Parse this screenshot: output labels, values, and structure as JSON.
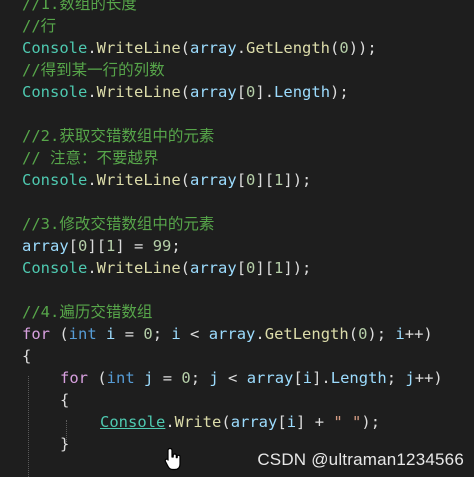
{
  "editor": {
    "lines": [
      {
        "indent": 0,
        "tokens": [
          {
            "t": "//1.数组的长度",
            "c": "comment"
          }
        ]
      },
      {
        "indent": 0,
        "tokens": [
          {
            "t": "//行",
            "c": "comment"
          }
        ]
      },
      {
        "indent": 0,
        "tokens": [
          {
            "t": "Console",
            "c": "class"
          },
          {
            "t": ".",
            "c": "punct"
          },
          {
            "t": "WriteLine",
            "c": "method"
          },
          {
            "t": "(",
            "c": "punct"
          },
          {
            "t": "array",
            "c": "var"
          },
          {
            "t": ".",
            "c": "punct"
          },
          {
            "t": "GetLength",
            "c": "method"
          },
          {
            "t": "(",
            "c": "punct"
          },
          {
            "t": "0",
            "c": "number"
          },
          {
            "t": "));",
            "c": "punct"
          }
        ]
      },
      {
        "indent": 0,
        "tokens": [
          {
            "t": "//得到某一行的列数",
            "c": "comment"
          }
        ]
      },
      {
        "indent": 0,
        "tokens": [
          {
            "t": "Console",
            "c": "class"
          },
          {
            "t": ".",
            "c": "punct"
          },
          {
            "t": "WriteLine",
            "c": "method"
          },
          {
            "t": "(",
            "c": "punct"
          },
          {
            "t": "array",
            "c": "var"
          },
          {
            "t": "[",
            "c": "punct"
          },
          {
            "t": "0",
            "c": "number"
          },
          {
            "t": "].",
            "c": "punct"
          },
          {
            "t": "Length",
            "c": "var"
          },
          {
            "t": ");",
            "c": "punct"
          }
        ]
      },
      {
        "indent": 0,
        "tokens": []
      },
      {
        "indent": 0,
        "tokens": [
          {
            "t": "//2.获取交错数组中的元素",
            "c": "comment"
          }
        ]
      },
      {
        "indent": 0,
        "tokens": [
          {
            "t": "// 注意：不要越界",
            "c": "comment"
          }
        ]
      },
      {
        "indent": 0,
        "tokens": [
          {
            "t": "Console",
            "c": "class"
          },
          {
            "t": ".",
            "c": "punct"
          },
          {
            "t": "WriteLine",
            "c": "method"
          },
          {
            "t": "(",
            "c": "punct"
          },
          {
            "t": "array",
            "c": "var"
          },
          {
            "t": "[",
            "c": "punct"
          },
          {
            "t": "0",
            "c": "number"
          },
          {
            "t": "][",
            "c": "punct"
          },
          {
            "t": "1",
            "c": "number"
          },
          {
            "t": "]);",
            "c": "punct"
          }
        ]
      },
      {
        "indent": 0,
        "tokens": []
      },
      {
        "indent": 0,
        "tokens": [
          {
            "t": "//3.修改交错数组中的元素",
            "c": "comment"
          }
        ]
      },
      {
        "indent": 0,
        "tokens": [
          {
            "t": "array",
            "c": "var"
          },
          {
            "t": "[",
            "c": "punct"
          },
          {
            "t": "0",
            "c": "number"
          },
          {
            "t": "][",
            "c": "punct"
          },
          {
            "t": "1",
            "c": "number"
          },
          {
            "t": "] = ",
            "c": "punct"
          },
          {
            "t": "99",
            "c": "number"
          },
          {
            "t": ";",
            "c": "punct"
          }
        ]
      },
      {
        "indent": 0,
        "tokens": [
          {
            "t": "Console",
            "c": "class"
          },
          {
            "t": ".",
            "c": "punct"
          },
          {
            "t": "WriteLine",
            "c": "method"
          },
          {
            "t": "(",
            "c": "punct"
          },
          {
            "t": "array",
            "c": "var"
          },
          {
            "t": "[",
            "c": "punct"
          },
          {
            "t": "0",
            "c": "number"
          },
          {
            "t": "][",
            "c": "punct"
          },
          {
            "t": "1",
            "c": "number"
          },
          {
            "t": "]);",
            "c": "punct"
          }
        ]
      },
      {
        "indent": 0,
        "tokens": []
      },
      {
        "indent": 0,
        "tokens": [
          {
            "t": "//4.遍历交错数组",
            "c": "comment"
          }
        ]
      },
      {
        "indent": 0,
        "tokens": [
          {
            "t": "for",
            "c": "control"
          },
          {
            "t": " (",
            "c": "punct"
          },
          {
            "t": "int",
            "c": "keyword"
          },
          {
            "t": " ",
            "c": "punct"
          },
          {
            "t": "i",
            "c": "var"
          },
          {
            "t": " = ",
            "c": "punct"
          },
          {
            "t": "0",
            "c": "number"
          },
          {
            "t": "; ",
            "c": "punct"
          },
          {
            "t": "i",
            "c": "var"
          },
          {
            "t": " < ",
            "c": "punct"
          },
          {
            "t": "array",
            "c": "var"
          },
          {
            "t": ".",
            "c": "punct"
          },
          {
            "t": "GetLength",
            "c": "method"
          },
          {
            "t": "(",
            "c": "punct"
          },
          {
            "t": "0",
            "c": "number"
          },
          {
            "t": "); ",
            "c": "punct"
          },
          {
            "t": "i",
            "c": "var"
          },
          {
            "t": "++)",
            "c": "punct"
          }
        ]
      },
      {
        "indent": 0,
        "tokens": [
          {
            "t": "{",
            "c": "punct"
          }
        ]
      },
      {
        "indent": 1,
        "tokens": [
          {
            "t": "for",
            "c": "control"
          },
          {
            "t": " (",
            "c": "punct"
          },
          {
            "t": "int",
            "c": "keyword"
          },
          {
            "t": " ",
            "c": "punct"
          },
          {
            "t": "j",
            "c": "var"
          },
          {
            "t": " = ",
            "c": "punct"
          },
          {
            "t": "0",
            "c": "number"
          },
          {
            "t": "; ",
            "c": "punct"
          },
          {
            "t": "j",
            "c": "var"
          },
          {
            "t": " < ",
            "c": "punct"
          },
          {
            "t": "array",
            "c": "var"
          },
          {
            "t": "[",
            "c": "punct"
          },
          {
            "t": "i",
            "c": "var"
          },
          {
            "t": "].",
            "c": "punct"
          },
          {
            "t": "Length",
            "c": "var"
          },
          {
            "t": "; ",
            "c": "punct"
          },
          {
            "t": "j",
            "c": "var"
          },
          {
            "t": "++)",
            "c": "punct"
          }
        ]
      },
      {
        "indent": 1,
        "tokens": [
          {
            "t": "{",
            "c": "punct"
          }
        ]
      },
      {
        "indent": 2,
        "tokens": [
          {
            "t": "Console",
            "c": "class",
            "link": true
          },
          {
            "t": ".",
            "c": "punct"
          },
          {
            "t": "Write",
            "c": "method"
          },
          {
            "t": "(",
            "c": "punct"
          },
          {
            "t": "array",
            "c": "var"
          },
          {
            "t": "[",
            "c": "punct"
          },
          {
            "t": "i",
            "c": "var"
          },
          {
            "t": "] + ",
            "c": "punct"
          },
          {
            "t": "\" \"",
            "c": "string"
          },
          {
            "t": ");",
            "c": "punct"
          }
        ]
      },
      {
        "indent": 1,
        "tokens": [
          {
            "t": "}",
            "c": "punct"
          }
        ]
      }
    ]
  },
  "watermark": {
    "text": "CSDN @ultraman1234566"
  },
  "colors": {
    "background": "#1e1e1e",
    "comment": "#57a64a",
    "class": "#4ec9b0",
    "method": "#dcdcaa",
    "variable": "#9cdcfe",
    "number": "#b5cea8",
    "keyword": "#569cd6",
    "control": "#d8a0df",
    "string": "#d69d85",
    "text": "#dcdcdc"
  },
  "mouse_cursor_icon": "hand-pointer-icon"
}
